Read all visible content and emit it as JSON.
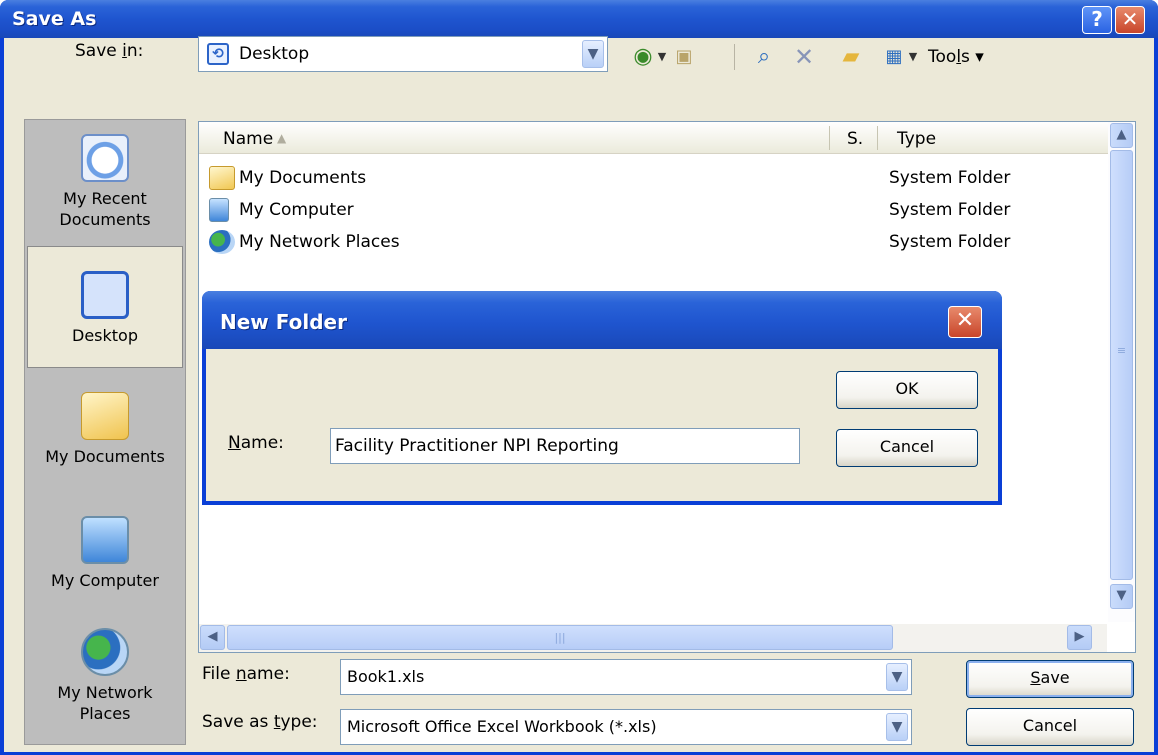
{
  "window": {
    "title": "Save As"
  },
  "title_buttons": {
    "help": "?",
    "close": "✕"
  },
  "toolbar": {
    "save_in_label_pre": "Save ",
    "save_in_label_u": "i",
    "save_in_label_post": "n:",
    "save_in_value": "Desktop",
    "tools_pre": "Too",
    "tools_u": "l",
    "tools_post": "s ▾"
  },
  "places": [
    {
      "label": "My Recent Documents",
      "line1": "My Recent",
      "line2": "Documents"
    },
    {
      "label": "Desktop"
    },
    {
      "label": "My Documents"
    },
    {
      "label": "My Computer"
    },
    {
      "label": "My Network Places",
      "line1": "My Network",
      "line2": "Places"
    }
  ],
  "columns": {
    "name": "Name",
    "size": "S.",
    "type": "Type"
  },
  "files": [
    {
      "name": "My Documents",
      "type": "System Folder"
    },
    {
      "name": "My Computer",
      "type": "System Folder"
    },
    {
      "name": "My Network Places",
      "type": "System Folder"
    }
  ],
  "bottom": {
    "file_name_pre": "File ",
    "file_name_u": "n",
    "file_name_post": "ame:",
    "file_name_value": "Book1.xls",
    "save_type_pre": "Save as ",
    "save_type_u": "t",
    "save_type_post": "ype:",
    "save_type_value": "Microsoft Office Excel Workbook (*.xls)",
    "save_pre": "",
    "save_u": "S",
    "save_post": "ave",
    "cancel": "Cancel"
  },
  "new_folder": {
    "title": "New Folder",
    "close": "✕",
    "name_u": "N",
    "name_post": "ame:",
    "name_value": "Facility Practitioner NPI Reporting",
    "ok": "OK",
    "cancel": "Cancel"
  },
  "colors": {
    "title_blue": "#1f55cf",
    "dialog_face": "#ece9d8",
    "close_red": "#c8452a",
    "field_border": "#7f9db9"
  }
}
